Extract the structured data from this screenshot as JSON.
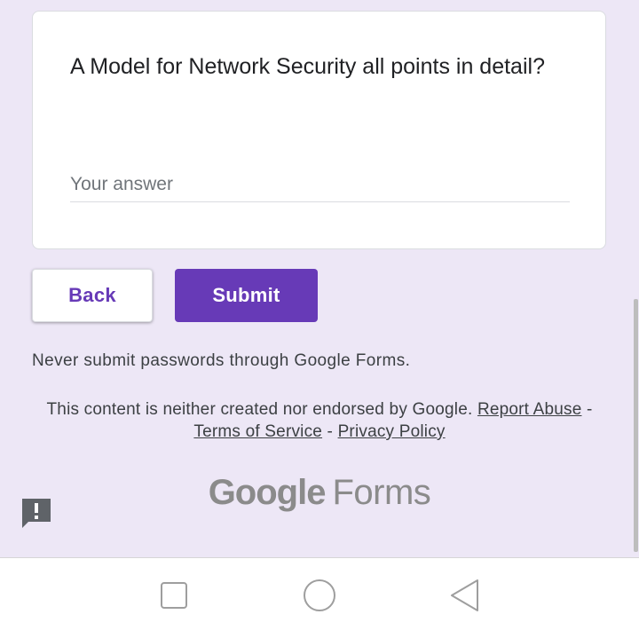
{
  "question": {
    "title": "A Model for Network Security all points in detail?",
    "answer_value": "",
    "answer_placeholder": "Your answer"
  },
  "buttons": {
    "back_label": "Back",
    "submit_label": "Submit"
  },
  "footer": {
    "warning": "Never submit passwords through Google Forms.",
    "disclaimer_text": "This content is neither created nor endorsed by Google.",
    "report_link": "Report Abuse",
    "separator": "-",
    "terms_link": "Terms of Service",
    "privacy_link": "Privacy Policy",
    "brand_google": "Google",
    "brand_forms": "Forms"
  },
  "icons": {
    "report": "report-exclamation-icon",
    "nav_recents": "square-icon",
    "nav_home": "circle-icon",
    "nav_back": "triangle-back-icon"
  },
  "colors": {
    "background": "#ede7f6",
    "accent": "#673ab7"
  }
}
